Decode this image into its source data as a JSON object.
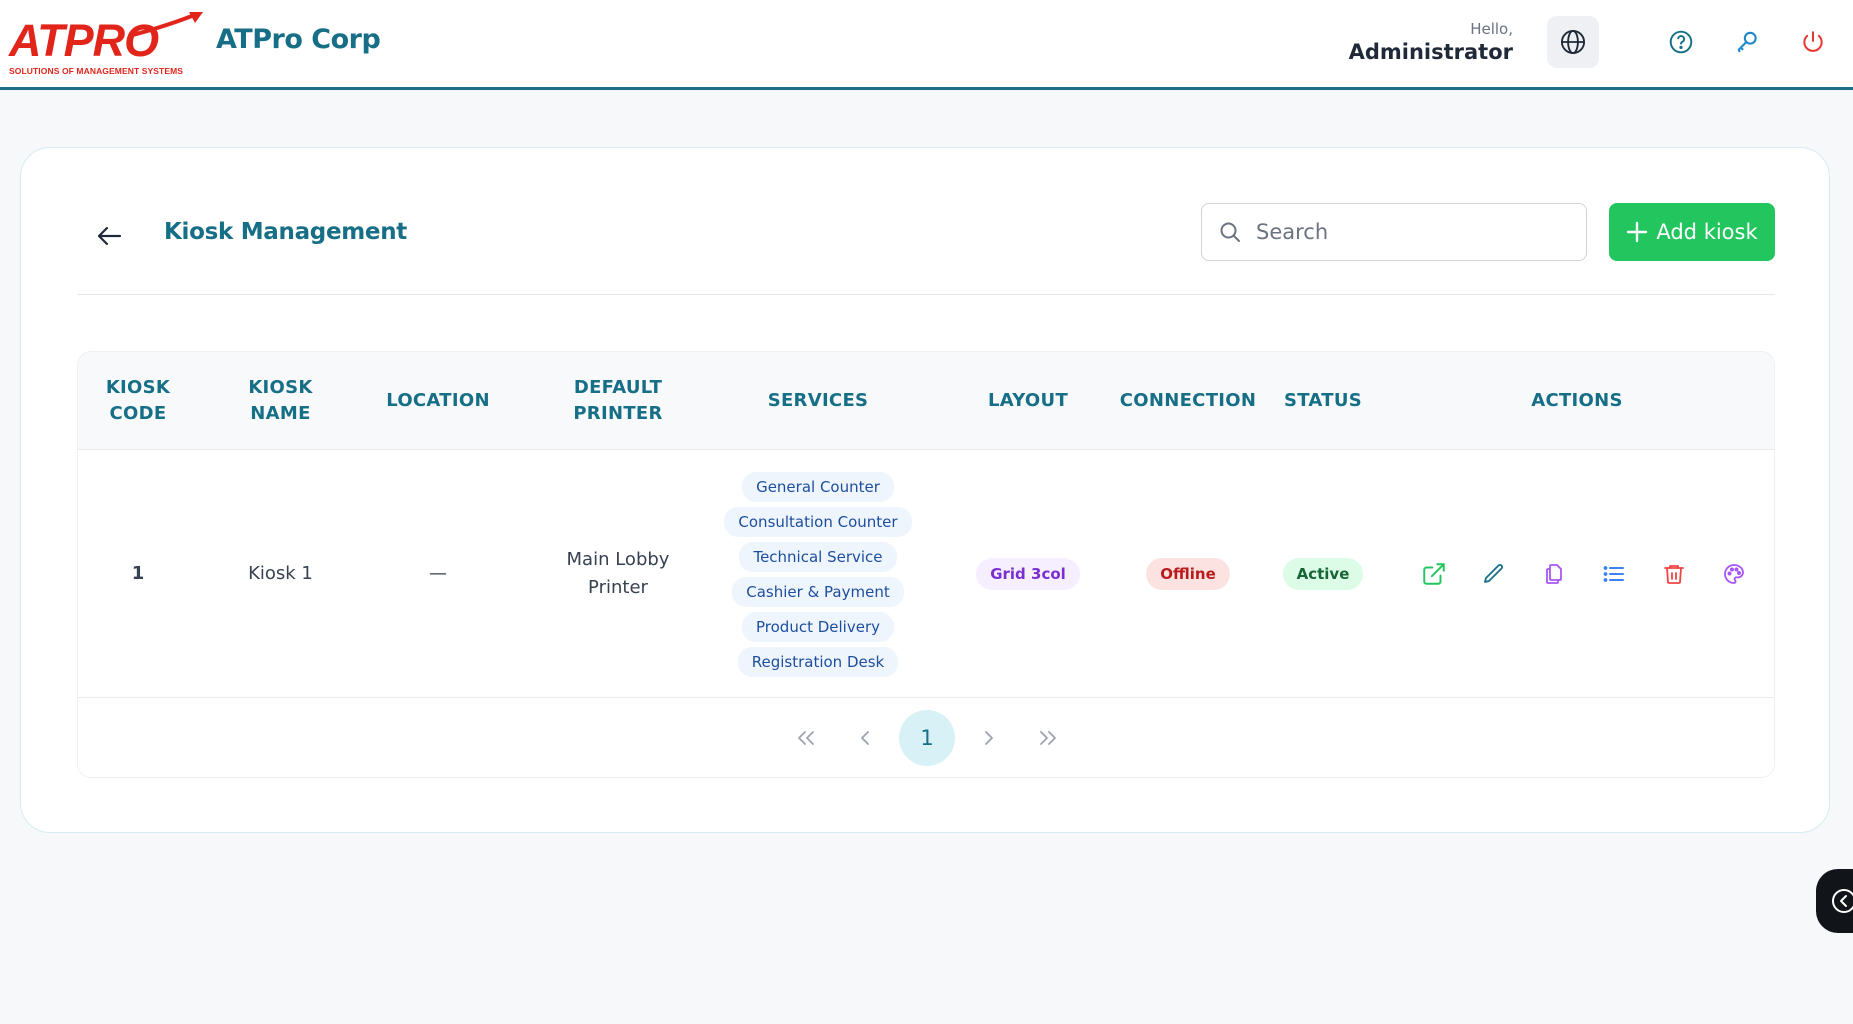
{
  "header": {
    "logo_text": "ATPRO",
    "logo_tagline": "SOLUTIONS OF MANAGEMENT SYSTEMS",
    "company": "ATPro Corp",
    "greeting": "Hello,",
    "user": "Administrator",
    "icons": [
      "globe-icon",
      "help-icon",
      "key-icon",
      "power-icon"
    ]
  },
  "page": {
    "title": "Kiosk Management",
    "search_placeholder": "Search",
    "add_button": "Add kiosk"
  },
  "table": {
    "columns": [
      "KIOSK CODE",
      "KIOSK NAME",
      "LOCATION",
      "DEFAULT PRINTER",
      "SERVICES",
      "LAYOUT",
      "CONNECTION",
      "STATUS",
      "ACTIONS"
    ],
    "rows": [
      {
        "code": "1",
        "name": "Kiosk 1",
        "location": "—",
        "printer": "Main Lobby Printer",
        "services": [
          "General Counter",
          "Consultation Counter",
          "Technical Service",
          "Cashier & Payment",
          "Product Delivery",
          "Registration Desk"
        ],
        "layout": "Grid 3col",
        "connection": "Offline",
        "status": "Active",
        "actions": [
          "open-external-icon",
          "edit-icon",
          "copy-icon",
          "list-icon",
          "delete-icon",
          "palette-icon"
        ]
      }
    ]
  },
  "pagination": {
    "current": "1",
    "first": "«",
    "prev": "‹",
    "next": "›",
    "last": "»"
  },
  "colors": {
    "brand": "#166f86",
    "logo_red": "#e1251b",
    "add_button": "#22c55e",
    "offline": "#b91c1c",
    "active": "#166534"
  }
}
